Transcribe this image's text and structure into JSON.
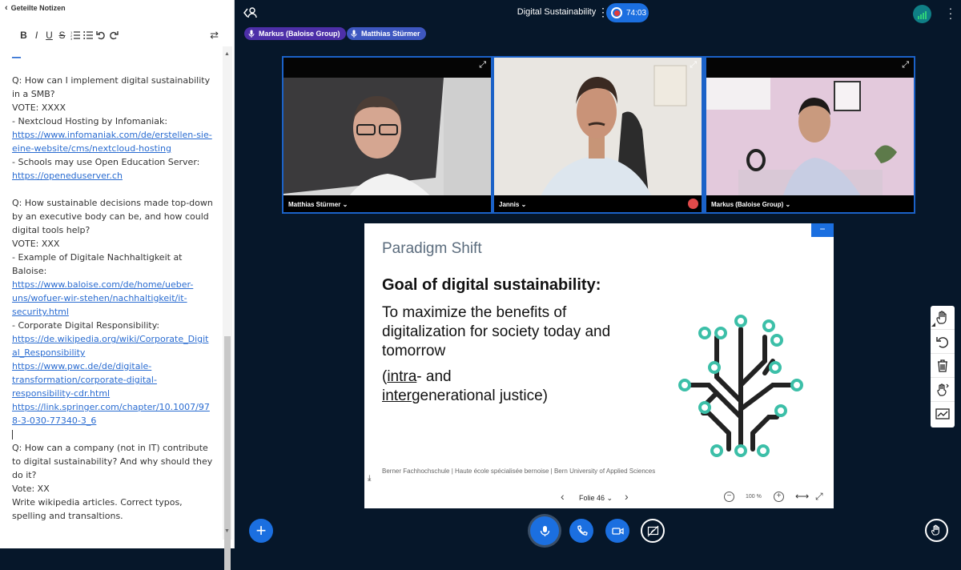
{
  "notes": {
    "title": "Geteilte Notizen",
    "toolbar": [
      "B",
      "I",
      "U",
      "S"
    ],
    "lines": [
      {
        "t": "",
        "link": true
      },
      {
        "t": ""
      },
      {
        "t": "Q: How can I implement digital sustainability"
      },
      {
        "t": "in a SMB?"
      },
      {
        "t": "VOTE: XXXX"
      },
      {
        "t": "- Nextcloud Hosting by Infomaniak:"
      },
      {
        "t": "https://www.infomaniak.com/de/erstellen-sie-",
        "link": true
      },
      {
        "t": "eine-website/cms/nextcloud-hosting",
        "link": true
      },
      {
        "t": "- Schools may use Open Education Server:"
      },
      {
        "t": "https://openeduserver.ch",
        "link": true
      },
      {
        "t": ""
      },
      {
        "t": "Q: How sustainable decisions made top-down"
      },
      {
        "t": "by an executive body can be, and how could"
      },
      {
        "t": "digital tools help?"
      },
      {
        "t": "VOTE: XXX"
      },
      {
        "t": "- Example of Digitale Nachhaltigkeit at"
      },
      {
        "t": "Baloise:"
      },
      {
        "t": "https://www.baloise.com/de/home/ueber-",
        "link": true
      },
      {
        "t": "uns/wofuer-wir-stehen/nachhaltigkeit/it-",
        "link": true
      },
      {
        "t": "security.html",
        "link": true
      },
      {
        "t": "- Corporate Digital Responsibility:"
      },
      {
        "t": "https://de.wikipedia.org/wiki/Corporate_Digit",
        "link": true
      },
      {
        "t": "al_Responsibility",
        "link": true
      },
      {
        "t": "https://www.pwc.de/de/digitale-",
        "link": true
      },
      {
        "t": "transformation/corporate-digital-",
        "link": true
      },
      {
        "t": "responsibility-cdr.html",
        "link": true
      },
      {
        "t": "https://link.springer.com/chapter/10.1007/97",
        "link": true
      },
      {
        "t": "8-3-030-77340-3_6",
        "link": true
      },
      {
        "t": "",
        "caret": true
      },
      {
        "t": "Q: How can a company (not in IT) contribute"
      },
      {
        "t": "to digital sustainability? And why should they"
      },
      {
        "t": "do it?"
      },
      {
        "t": "Vote: XX"
      },
      {
        "t": "Write wikipedia articles. Correct typos,"
      },
      {
        "t": "spelling and transaltions."
      }
    ]
  },
  "top": {
    "meeting_title": "Digital Sustainability",
    "recording_time": "74:03"
  },
  "talkers": [
    "Markus (Baloise Group)",
    "Matthias Stürmer"
  ],
  "videos": [
    {
      "name": "Matthias Stürmer ⌄",
      "muted": false
    },
    {
      "name": "Jannis ⌄",
      "muted": true
    },
    {
      "name": "Markus (Baloise Group) ⌄",
      "muted": false
    }
  ],
  "slide": {
    "subtitle": "Paradigm Shift",
    "heading": "Goal of digital sustainability:",
    "body": "To maximize the benefits of digitalization for society today and tomorrow",
    "note_intra": "intra",
    "note_mid": "- and",
    "note_inter": "inter",
    "note_rest": "generational justice)",
    "note_open": "(",
    "footer": "Berner Fachhochschule | Haute école spécialisée bernoise | Bern University of Applied Sciences",
    "page_label": "Folie 46",
    "zoom": "100 %"
  },
  "colors": {
    "background": "#06172a",
    "accent": "#1b6fe0",
    "tree_dark": "#222222",
    "tree_node": "#3cbfa8"
  }
}
